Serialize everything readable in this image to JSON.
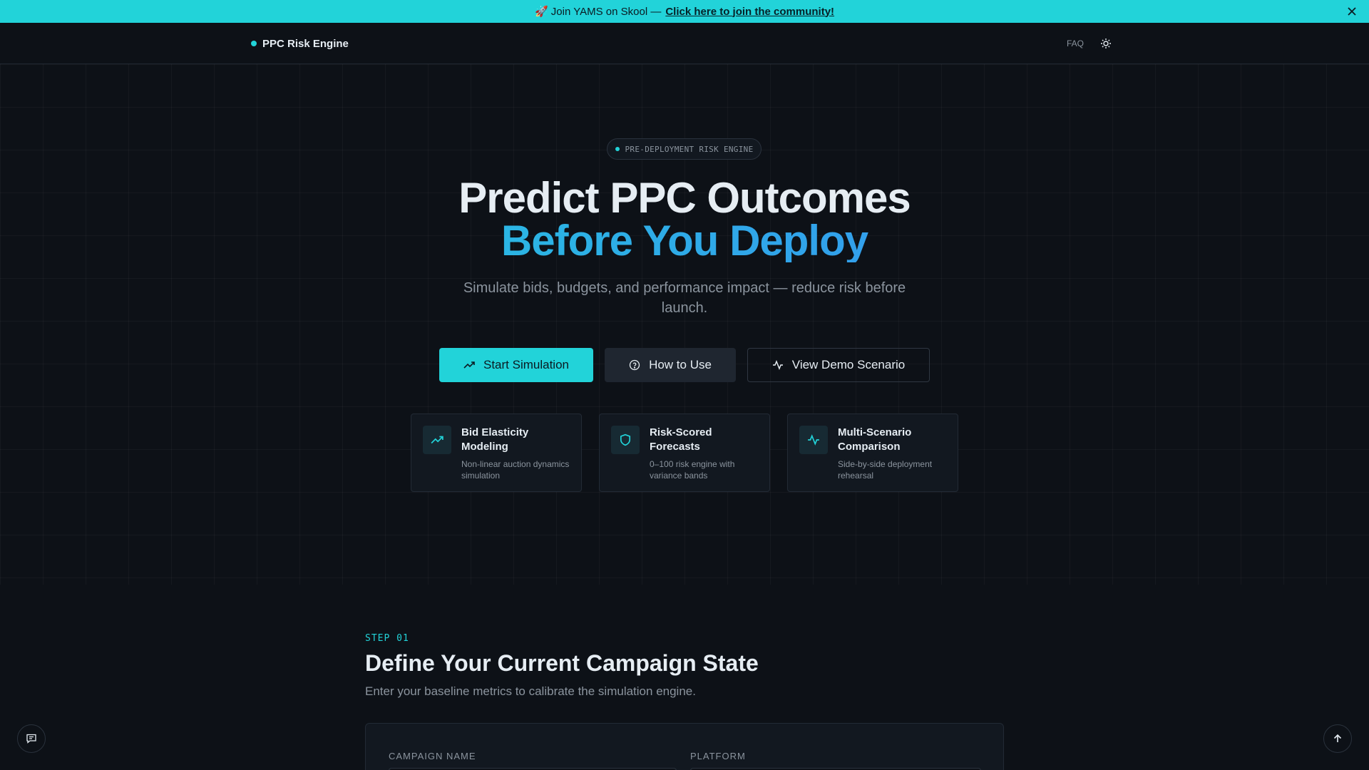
{
  "banner": {
    "prefix": "🚀 Join YAMS on Skool —",
    "link": "Click here to join the community!",
    "close": "✕"
  },
  "nav": {
    "brand": "PPC Risk Engine",
    "faq": "FAQ"
  },
  "hero": {
    "pill": "PRE-DEPLOYMENT RISK ENGINE",
    "headline_line1": "Predict PPC Outcomes",
    "headline_line2": "Before You Deploy",
    "subtitle": "Simulate bids, budgets, and performance impact — reduce risk before launch.",
    "buttons": {
      "start": "Start Simulation",
      "how": "How to Use",
      "demo": "View Demo Scenario"
    },
    "features": [
      {
        "title": "Bid Elasticity Modeling",
        "desc": "Non-linear auction dynamics simulation",
        "icon": "trending-up-icon"
      },
      {
        "title": "Risk-Scored Forecasts",
        "desc": "0–100 risk engine with variance bands",
        "icon": "shield-icon"
      },
      {
        "title": "Multi-Scenario Comparison",
        "desc": "Side-by-side deployment rehearsal",
        "icon": "activity-icon"
      }
    ]
  },
  "step": {
    "label": "STEP 01",
    "title": "Define Your Current Campaign State",
    "subtitle": "Enter your baseline metrics to calibrate the simulation engine.",
    "fields": {
      "campaign_name": "CAMPAIGN NAME",
      "platform": "PLATFORM"
    }
  },
  "colors": {
    "accent": "#22d3d9",
    "gradient_end": "#3b82f6",
    "background": "#0d1117"
  }
}
